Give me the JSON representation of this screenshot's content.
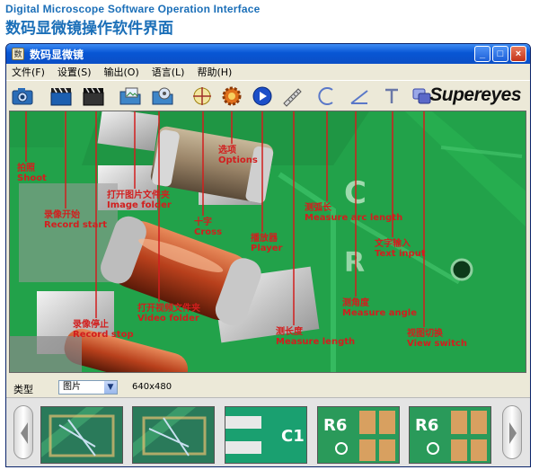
{
  "header": {
    "title_en": "Digital Microscope Software Operation Interface",
    "title_zh": "数码显微镜操作软件界面"
  },
  "window": {
    "title": "数码显微镜",
    "app_icon_glyph": "数",
    "controls": {
      "minimize": "_",
      "maximize": "□",
      "close": "×"
    }
  },
  "menu": {
    "items": [
      {
        "label": "文件(F)"
      },
      {
        "label": "设置(S)"
      },
      {
        "label": "输出(O)"
      },
      {
        "label": "语言(L)"
      },
      {
        "label": "帮助(H)"
      }
    ]
  },
  "toolbar": {
    "logo": "Supereyes",
    "tools": [
      {
        "name": "shoot-tool",
        "icon": "camera-icon",
        "color": "#2a6db8"
      },
      {
        "name": "record-start-tool",
        "icon": "film-clapper-icon",
        "color": "#1c5fb0"
      },
      {
        "name": "record-stop-tool",
        "icon": "film-clapper-stop-icon",
        "color": "#333333"
      },
      {
        "name": "image-folder-tool",
        "icon": "image-folder-icon",
        "color": "#3e86c8"
      },
      {
        "name": "video-folder-tool",
        "icon": "video-folder-icon",
        "color": "#3e86c8"
      },
      {
        "name": "crosshair-tool",
        "icon": "crosshair-icon",
        "color": "#c0a020"
      },
      {
        "name": "options-tool",
        "icon": "gear-icon",
        "color": "#d0601c"
      },
      {
        "name": "player-tool",
        "icon": "play-icon",
        "color": "#1c4fc8"
      },
      {
        "name": "measure-length-tool",
        "icon": "ruler-icon",
        "color": "#707070"
      },
      {
        "name": "measure-arc-tool",
        "icon": "arc-icon",
        "color": "#5a78c8"
      },
      {
        "name": "measure-angle-tool",
        "icon": "angle-icon",
        "color": "#5a78c8"
      },
      {
        "name": "text-input-tool",
        "icon": "text-t-icon",
        "color": "#6a78a8"
      },
      {
        "name": "view-switch-tool",
        "icon": "view-switch-icon",
        "color": "#5a68c8"
      }
    ]
  },
  "annotations": [
    {
      "zh": "拍照",
      "en": "Shoot"
    },
    {
      "zh": "录像开始",
      "en": "Record start"
    },
    {
      "zh": "录像停止",
      "en": "Record stop"
    },
    {
      "zh": "打开图片文件夹",
      "en": "Image folder"
    },
    {
      "zh": "打开视频文件夹",
      "en": "Video folder"
    },
    {
      "zh": "十字",
      "en": "Cross"
    },
    {
      "zh": "选项",
      "en": "Options"
    },
    {
      "zh": "播放器",
      "en": "Player"
    },
    {
      "zh": "测长度",
      "en": "Measure length"
    },
    {
      "zh": "测弧长",
      "en": "Measure arc length"
    },
    {
      "zh": "测角度",
      "en": "Measure angle"
    },
    {
      "zh": "文字输入",
      "en": "Text input"
    },
    {
      "zh": "视图切换",
      "en": "View switch"
    }
  ],
  "status": {
    "type_label": "类型",
    "type_value": "图片",
    "resolution": "640x480"
  },
  "thumbnails": {
    "prev_arrow": "◀",
    "next_arrow": "▶",
    "items": [
      {
        "label": ""
      },
      {
        "label": ""
      },
      {
        "label": "C1"
      },
      {
        "label": "R6"
      },
      {
        "label": "R6"
      }
    ]
  },
  "colors": {
    "annotation": "#d21e1e",
    "pcb_green": "#22a24a",
    "title_blue": "#1b6fb8"
  }
}
